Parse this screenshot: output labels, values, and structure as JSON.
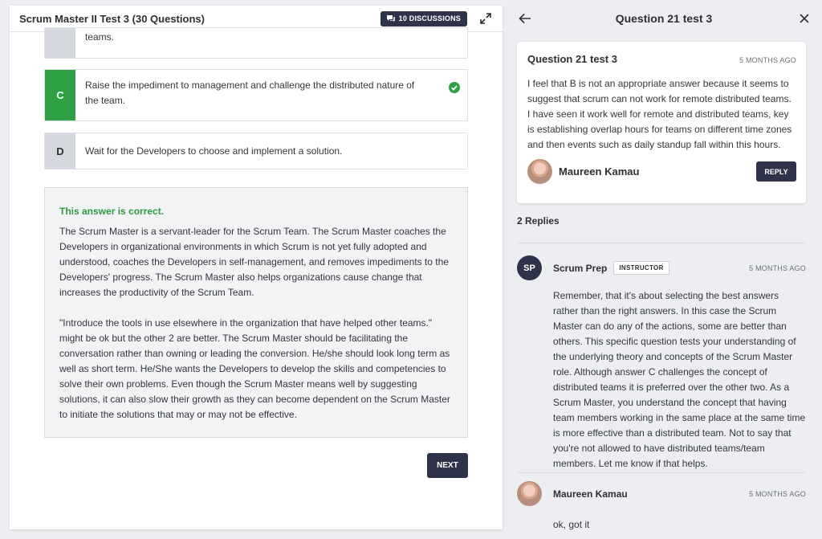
{
  "left": {
    "title": "Scrum Master II Test 3 (30 Questions)",
    "discussions_label": "10 DISCUSSIONS",
    "options": [
      {
        "letter": "",
        "text": "teams."
      },
      {
        "letter": "C",
        "text": "Raise the impediment to management and challenge the distributed nature of the team."
      },
      {
        "letter": "D",
        "text": "Wait for the Developers to choose and implement a solution."
      }
    ],
    "explanation": {
      "status": "This answer is correct.",
      "paragraphs": [
        "The Scrum Master is a servant-leader for the Scrum Team. The Scrum Master coaches the Developers in organizational environments in which Scrum is not yet fully adopted and understood, coaches the Developers in self-management, and removes impediments to the Developers' progress. The Scrum Master also helps organizations cause change that increases the productivity of the Scrum Team.",
        "\"Introduce the tools in use elsewhere in the organization that have helped other teams.\" might be ok but the other 2 are better. The Scrum Master should be facilitating the conversation rather than owning or leading the conversion. He/she should look long term as well as short term. He/She wants the Developers to develop the skills and competencies to solve their own problems. Even though the Scrum Master means well by suggesting solutions, it can also slow their growth as they can become dependent on the Scrum Master to initiate the solutions that may or may not be effective."
      ]
    },
    "next_label": "NEXT"
  },
  "right": {
    "title": "Question 21 test 3",
    "post": {
      "title": "Question 21 test 3",
      "time": "5 MONTHS AGO",
      "body": "I feel that B is not an appropriate answer because it seems to suggest that scrum can not work for remote distributed teams. I have seen it work well for remote and distributed teams, key is establishing overlap hours for teams on different time zones and then events such as daily standup fall within this hours.",
      "author": "Maureen Kamau",
      "reply_label": "REPLY"
    },
    "replies_count": "2 Replies",
    "replies": [
      {
        "initials": "SP",
        "author": "Scrum Prep",
        "badge": "INSTRUCTOR",
        "time": "5 MONTHS AGO",
        "body": "Remember, that it's about selecting the best answers rather than the right answers. In this case the Scrum Master can do any of the actions, some are better than others. This specific question tests your understanding of the underlying theory and concepts of the Scrum Master role. Although answer C challenges the concept of distributed teams it is preferred over the other two. As a Scrum Master, you understand the concept that having team members working in the same place at the same time is more effective than a distributed team. Not to say that you're not allowed to have distributed teams/team members. Let me know if that helps."
      },
      {
        "author": "Maureen Kamau",
        "time": "5 MONTHS AGO",
        "body": "ok, got it"
      }
    ]
  },
  "colors": {
    "dark_navy": "#2f3349",
    "correct_green": "#2ea043",
    "page_bg": "#eceef1"
  },
  "icons": [
    "chat-icon",
    "expand-icon",
    "check-circle-icon",
    "back-arrow-icon",
    "close-icon"
  ]
}
